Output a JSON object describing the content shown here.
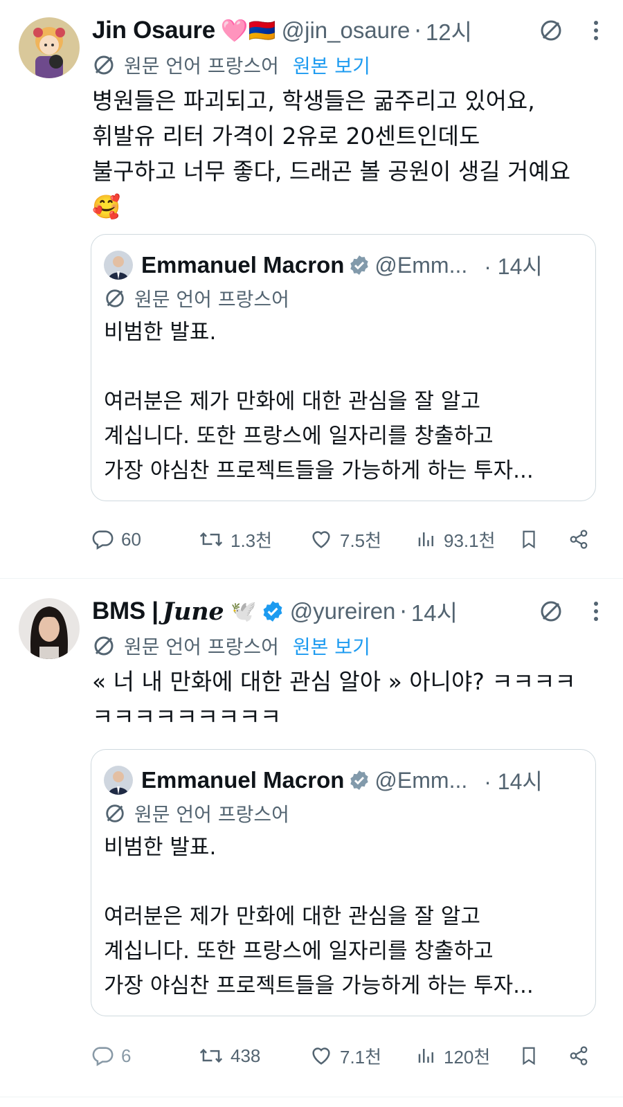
{
  "tweets": [
    {
      "author": {
        "name": "Jin Osaure",
        "emoji": "🩷🇦🇲",
        "handle": "@jin_osaure",
        "time": "12시"
      },
      "translation": {
        "label": "원문 언어 프랑스어",
        "show_original": "원본 보기"
      },
      "text_lines": [
        "병원들은 파괴되고, 학생들은 굶주리고 있어요,",
        "휘발유 리터 가격이 2유로 20센트인데도",
        "불구하고 너무 좋다, 드래곤 볼 공원이 생길 거예요",
        "🥰"
      ],
      "quote": {
        "name": "Emmanuel Macron",
        "handle": "@Emm...",
        "time": "· 14시",
        "translation_label": "원문 언어 프랑스어",
        "lines": [
          "비범한 발표.",
          "",
          "여러분은 제가 만화에 대한 관심을 잘 알고",
          "계십니다. 또한 프랑스에 일자리를 창출하고",
          "가장 야심찬 프로젝트들을 가능하게 하는 투자..."
        ]
      },
      "actions": {
        "replies": "60",
        "retweets": "1.3천",
        "likes": "7.5천",
        "views": "93.1천"
      }
    },
    {
      "author": {
        "name": "BMS | ",
        "name_styled": "June",
        "emoji": "🕊️",
        "handle": "@yureiren",
        "time": "14시"
      },
      "translation": {
        "label": "원문 언어 프랑스어",
        "show_original": "원본 보기"
      },
      "text_lines": [
        "« 너 내 만화에 대한 관심 알아 » 아니야? ㅋㅋㅋㅋ",
        "ㅋㅋㅋㅋㅋㅋㅋㅋㅋ"
      ],
      "quote": {
        "name": "Emmanuel Macron",
        "handle": "@Emm...",
        "time": "· 14시",
        "translation_label": "원문 언어 프랑스어",
        "lines": [
          "비범한 발표.",
          "",
          "여러분은 제가 만화에 대한 관심을 잘 알고",
          "계십니다. 또한 프랑스에 일자리를 창출하고",
          "가장 야심찬 프로젝트들을 가능하게 하는 투자..."
        ]
      },
      "actions": {
        "replies": "6",
        "retweets": "438",
        "likes": "7.1천",
        "views": "120천"
      }
    }
  ],
  "colors": {
    "text": "#0f1419",
    "muted": "#536471",
    "link": "#1d9bf0",
    "border": "#cfd9de",
    "verified": "#1d9bf0"
  }
}
